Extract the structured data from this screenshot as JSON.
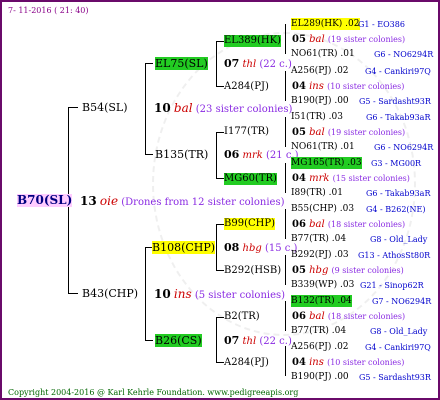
{
  "date": "7- 11-2016 ( 21: 40)",
  "root": {
    "label": "B70(SL)",
    "num": "13",
    "tag": "oie",
    "note": "(Drones from 12 sister colonies)"
  },
  "p1": {
    "label": "B54(SL)",
    "num": "10",
    "tag": "bal",
    "note": "(23 sister colonies)"
  },
  "p2": {
    "label": "B43(CHP)",
    "num": "10",
    "tag": "ins",
    "note": "(5 sister colonies)"
  },
  "g1": {
    "label": "EL75(SL)",
    "num": "07",
    "tag": "thl",
    "note": "(22 c.)"
  },
  "g2": {
    "label": "B135(TR)",
    "num": "06",
    "tag": "mrk",
    "note": "(21 c.)"
  },
  "g3": {
    "label": "B108(CHP)",
    "num": "08",
    "tag": "hbg",
    "note": "(15 c.)"
  },
  "g4": {
    "label": "B26(CS)",
    "num": "07",
    "tag": "thl",
    "note": "(22 c.)"
  },
  "m": [
    {
      "l": "EL389(HK)"
    },
    {
      "l": "A284(PJ)"
    },
    {
      "l": "I177(TR)"
    },
    {
      "l": "MG60(TR)"
    },
    {
      "l": "B99(CHP)"
    },
    {
      "l": "B292(HSB)"
    },
    {
      "l": "B2(TR)"
    },
    {
      "l": "A284(PJ)"
    }
  ],
  "m_notes": [
    {
      "num": "05",
      "tag": "bal",
      "note": "(19 sister colonies)"
    },
    {
      "num": "04",
      "tag": "ins",
      "note": "(10 sister colonies)"
    },
    {
      "num": "05",
      "tag": "bal",
      "note": "(19 sister colonies)"
    },
    {
      "num": "04",
      "tag": "mrk",
      "note": "(15 sister colonies)"
    },
    {
      "num": "06",
      "tag": "bal",
      "note": "(18 sister colonies)"
    },
    {
      "num": "05",
      "tag": "hbg",
      "note": "(9 sister colonies)"
    },
    {
      "num": "06",
      "tag": "bal",
      "note": "(18 sister colonies)"
    },
    {
      "num": "04",
      "tag": "ins",
      "note": "(10 sister colonies)"
    }
  ],
  "r": [
    {
      "l": "EL289(HK) .02",
      "g": "G1 - EO386"
    },
    {
      "l": "NO61(TR) .01",
      "g": "G6 - NO6294R"
    },
    {
      "l": "A256(PJ) .02",
      "g": "G4 - Cankiri97Q"
    },
    {
      "l": "B190(PJ) .00",
      "g": "G5 - Sardasht93R"
    },
    {
      "l": "I51(TR) .03",
      "g": "G6 - Takab93aR"
    },
    {
      "l": "NO61(TR) .01",
      "g": "G6 - NO6294R"
    },
    {
      "l": "MG165(TR) .03",
      "g": "G3 - MG00R"
    },
    {
      "l": "I89(TR) .01",
      "g": "G6 - Takab93aR"
    },
    {
      "l": "B55(CHP) .03",
      "g": "G4 - B262(NE)"
    },
    {
      "l": "B77(TR) .04",
      "g": "G8 - Old_Lady"
    },
    {
      "l": "B292(PJ) .03",
      "g": "G13 - AthosSt80R"
    },
    {
      "l": "B339(WP) .03",
      "g": "G21 - Sinop62R"
    },
    {
      "l": "B132(TR) .04",
      "g": "G7 - NO6294R"
    },
    {
      "l": "B77(TR) .04",
      "g": "G8 - Old_Lady"
    },
    {
      "l": "A256(PJ) .02",
      "g": "G4 - Cankiri97Q"
    },
    {
      "l": "B190(PJ) .00",
      "g": "G5 - Sardasht93R"
    }
  ],
  "copyright": "Copyright 2004-2016 @ Karl Kehrle Foundation.   www.pedigreeapis.org"
}
